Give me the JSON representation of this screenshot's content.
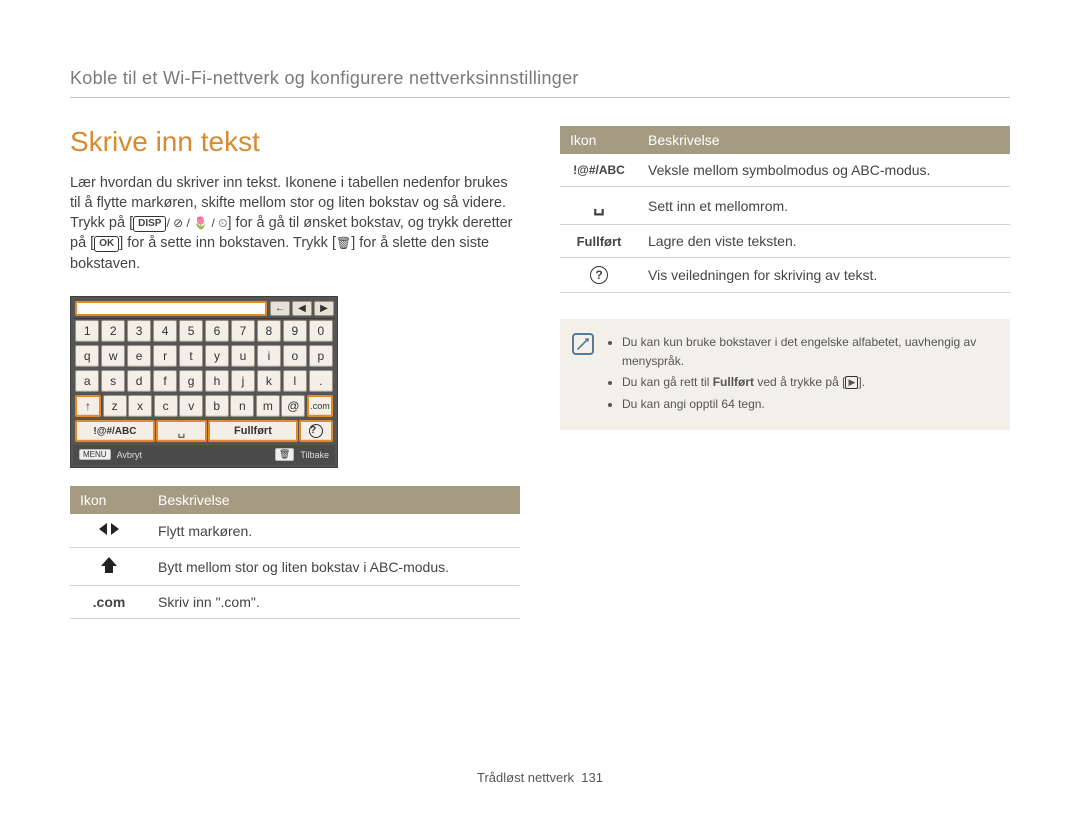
{
  "top_title": "Koble til et Wi-Fi-nettverk og konfigurere nettverksinnstillinger",
  "left": {
    "heading": "Skrive inn tekst",
    "para_before": "Lær hvordan du skriver inn tekst. Ikonene i tabellen nedenfor brukes til å flytte markøren, skifte mellom stor og liten bokstav og så videre. Trykk på [",
    "disp_label": "DISP",
    "para_mid1": "] for å gå til ønsket bokstav, og trykk deretter på [",
    "ok_label": "OK",
    "para_mid2": "] for å sette inn bokstaven. Trykk [",
    "para_after": "] for å slette den siste bokstaven.",
    "keyboard": {
      "top_back": "←",
      "top_left": "◀",
      "top_right": "▶",
      "row1": [
        "1",
        "2",
        "3",
        "4",
        "5",
        "6",
        "7",
        "8",
        "9",
        "0"
      ],
      "row2": [
        "q",
        "w",
        "e",
        "r",
        "t",
        "y",
        "u",
        "i",
        "o",
        "p"
      ],
      "row3": [
        "a",
        "s",
        "d",
        "f",
        "g",
        "h",
        "j",
        "k",
        "l",
        "."
      ],
      "row4_shift": "↑",
      "row4": [
        "z",
        "x",
        "c",
        "v",
        "b",
        "n",
        "m",
        "@"
      ],
      "row4_com": ".com",
      "bottom_mode": "!@#/ABC",
      "bottom_space": "␣",
      "bottom_done": "Fullført",
      "bottom_help": "?",
      "status_menu": "MENU",
      "status_cancel": "Avbryt",
      "status_back": "Tilbake"
    },
    "table": {
      "h_icon": "Ikon",
      "h_desc": "Beskrivelse",
      "rows": [
        {
          "icon": "◀ ▶",
          "desc": "Flytt markøren."
        },
        {
          "icon": "↑",
          "desc": "Bytt mellom stor og liten bokstav i ABC-modus."
        },
        {
          "icon": ".com",
          "desc": "Skriv inn \".com\"."
        }
      ]
    }
  },
  "right": {
    "table": {
      "h_icon": "Ikon",
      "h_desc": "Beskrivelse",
      "rows": [
        {
          "icon": "!@#/ABC",
          "desc": "Veksle mellom symbolmodus og ABC-modus."
        },
        {
          "icon": "␣",
          "desc": "Sett inn et mellomrom."
        },
        {
          "icon": "Fullført",
          "desc": "Lagre den viste teksten."
        },
        {
          "icon": "?",
          "desc": "Vis veiledningen for skriving av tekst."
        }
      ]
    },
    "note": {
      "b1": "Du kan kun bruke bokstaver i det engelske alfabetet, uavhengig av menyspråk.",
      "b2_a": "Du kan gå rett til ",
      "b2_bold": "Fullført",
      "b2_b": " ved å trykke på [",
      "b2_c": "].",
      "b3": "Du kan angi opptil 64 tegn."
    }
  },
  "footer": {
    "label": "Trådløst nettverk",
    "page": "131"
  }
}
